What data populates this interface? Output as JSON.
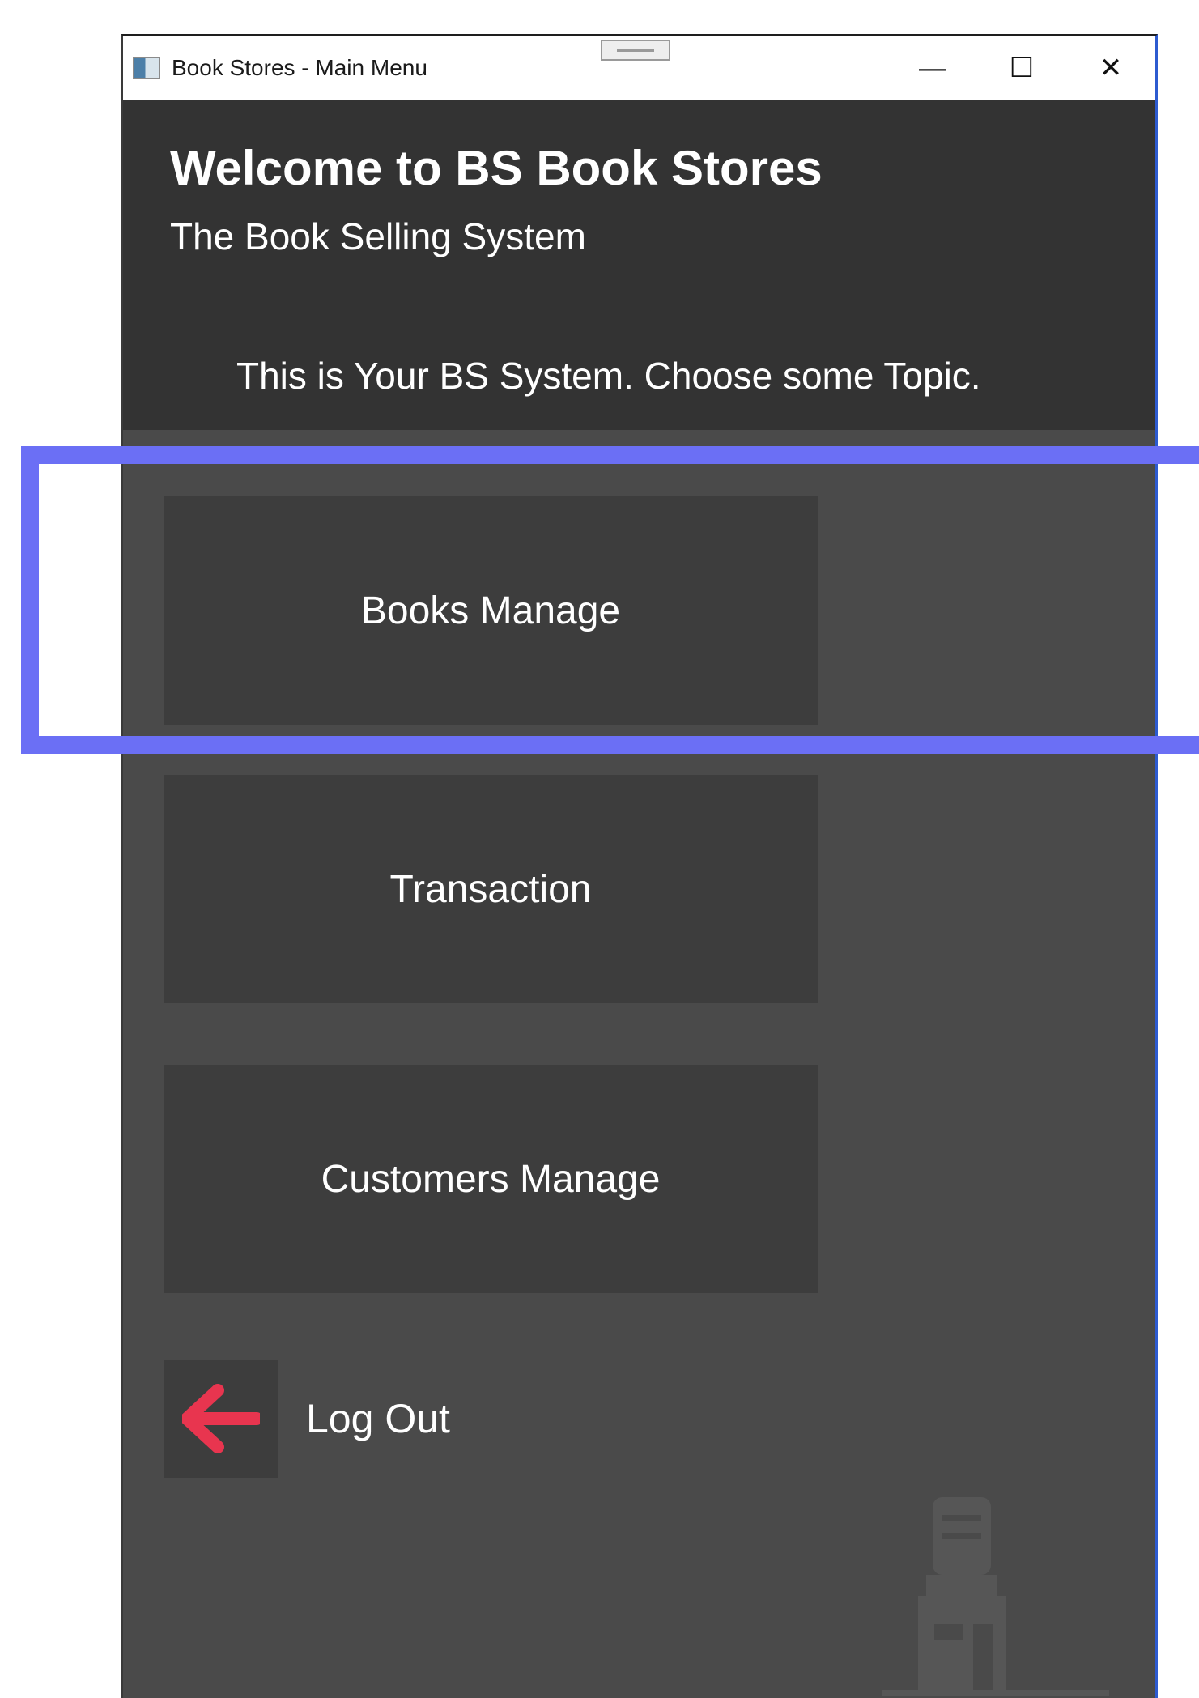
{
  "window": {
    "title": "Book Stores - Main Menu",
    "controls": {
      "minimize_symbol": "—",
      "maximize_symbol": "☐",
      "close_symbol": "✕"
    }
  },
  "header": {
    "title": "Welcome to BS Book Stores",
    "subtitle": "The Book Selling System",
    "instruction": "This is Your BS System. Choose some Topic."
  },
  "menu": {
    "books_manage": "Books Manage",
    "transaction": "Transaction",
    "customers_manage": "Customers Manage",
    "logout": "Log Out"
  },
  "icons": {
    "app": "app-window-icon",
    "logout": "arrow-left-icon",
    "store": "store-building-icon"
  },
  "colors": {
    "header_bg": "#333333",
    "body_bg": "#4a4a4a",
    "button_bg": "#3d3d3d",
    "logout_arrow": "#e8354f",
    "highlight": "#6b6ff5"
  }
}
